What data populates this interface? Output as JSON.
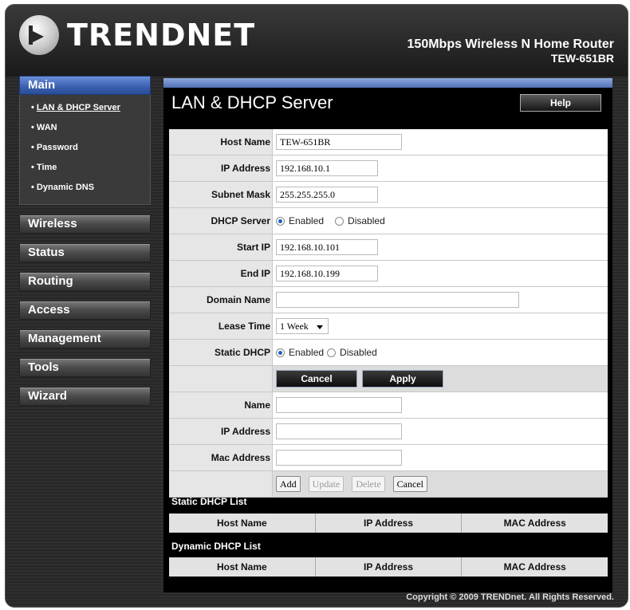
{
  "header": {
    "brand": "TRENDNET",
    "product_line1": "150Mbps Wireless N Home Router",
    "product_line2": "TEW-651BR"
  },
  "nav": {
    "main_label": "Main",
    "sub_items": [
      {
        "label": "LAN & DHCP Server",
        "active": true
      },
      {
        "label": "WAN"
      },
      {
        "label": "Password"
      },
      {
        "label": "Time"
      },
      {
        "label": "Dynamic DNS"
      }
    ],
    "sections": [
      "Wireless",
      "Status",
      "Routing",
      "Access",
      "Management",
      "Tools",
      "Wizard"
    ]
  },
  "page": {
    "title": "LAN & DHCP Server",
    "help_label": "Help"
  },
  "form": {
    "host_name": {
      "label": "Host Name",
      "value": "TEW-651BR"
    },
    "ip_address": {
      "label": "IP Address",
      "value": "192.168.10.1"
    },
    "subnet_mask": {
      "label": "Subnet Mask",
      "value": "255.255.255.0"
    },
    "dhcp_server": {
      "label": "DHCP Server",
      "option_enabled": "Enabled",
      "option_disabled": "Disabled",
      "selected": "Enabled"
    },
    "start_ip": {
      "label": "Start IP",
      "value": "192.168.10.101"
    },
    "end_ip": {
      "label": "End IP",
      "value": "192.168.10.199"
    },
    "domain_name": {
      "label": "Domain Name",
      "value": ""
    },
    "lease_time": {
      "label": "Lease Time",
      "value": "1 Week"
    },
    "static_dhcp": {
      "label": "Static DHCP",
      "option_enabled": "Enabled",
      "option_disabled": "Disabled",
      "selected": "Enabled"
    },
    "cancel_label": "Cancel",
    "apply_label": "Apply"
  },
  "static_entry": {
    "name_label": "Name",
    "ip_label": "IP Address",
    "mac_label": "Mac Address",
    "add_label": "Add",
    "update_label": "Update",
    "delete_label": "Delete",
    "cancel_label": "Cancel"
  },
  "static_list": {
    "title": "Static DHCP List",
    "columns": [
      "Host Name",
      "IP Address",
      "MAC Address"
    ]
  },
  "dynamic_list": {
    "title": "Dynamic DHCP List",
    "columns": [
      "Host Name",
      "IP Address",
      "MAC Address"
    ]
  },
  "footer": {
    "copyright": "Copyright © 2009 TRENDnet. All Rights Reserved."
  }
}
